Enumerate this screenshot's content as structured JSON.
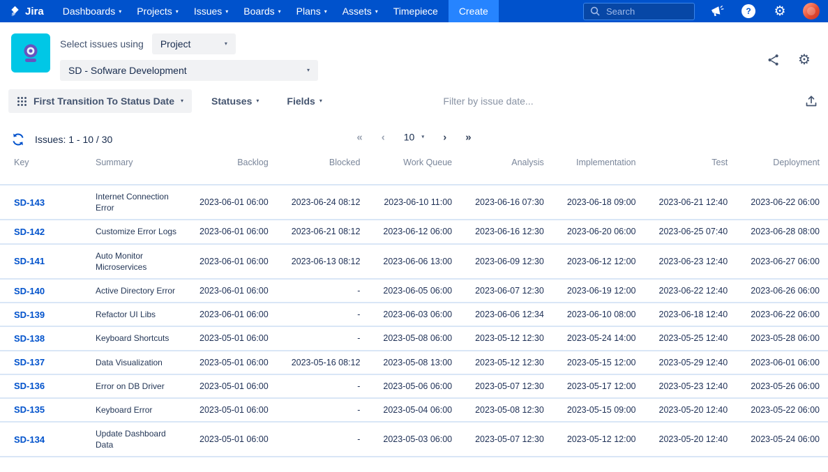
{
  "nav": {
    "brand": "Jira",
    "items": [
      {
        "label": "Dashboards",
        "chevron": true
      },
      {
        "label": "Projects",
        "chevron": true
      },
      {
        "label": "Issues",
        "chevron": true
      },
      {
        "label": "Boards",
        "chevron": true
      },
      {
        "label": "Plans",
        "chevron": true
      },
      {
        "label": "Assets",
        "chevron": true
      },
      {
        "label": "Timepiece",
        "chevron": false
      }
    ],
    "create_label": "Create",
    "search_placeholder": "Search",
    "icons": [
      "announcement-icon",
      "help-icon",
      "settings-icon",
      "user-avatar"
    ]
  },
  "gadget_header": {
    "select_label": "Select issues using",
    "mode_selected": "Project",
    "project_selected": "SD - Sofware Development"
  },
  "toolbar": {
    "field_selector": "First Transition To Status Date",
    "statuses": "Statuses",
    "fields": "Fields",
    "filter_placeholder": "Filter by issue date..."
  },
  "pagination": {
    "issues_label": "Issues: 1 - 10 / 30",
    "page_size": "10"
  },
  "table": {
    "columns": [
      "Key",
      "Summary",
      "Backlog",
      "Blocked",
      "Work Queue",
      "Analysis",
      "Implementation",
      "Test",
      "Deployment"
    ],
    "rows": [
      {
        "key": "SD-143",
        "summary": "Internet Connection Error",
        "dates": [
          "2023-06-01 06:00",
          "2023-06-24 08:12",
          "2023-06-10 11:00",
          "2023-06-16 07:30",
          "2023-06-18 09:00",
          "2023-06-21 12:40",
          "2023-06-22 06:00"
        ]
      },
      {
        "key": "SD-142",
        "summary": "Customize Error Logs",
        "dates": [
          "2023-06-01 06:00",
          "2023-06-21 08:12",
          "2023-06-12 06:00",
          "2023-06-16 12:30",
          "2023-06-20 06:00",
          "2023-06-25 07:40",
          "2023-06-28 08:00"
        ]
      },
      {
        "key": "SD-141",
        "summary": "Auto Monitor Microservices",
        "dates": [
          "2023-06-01 06:00",
          "2023-06-13 08:12",
          "2023-06-06 13:00",
          "2023-06-09 12:30",
          "2023-06-12 12:00",
          "2023-06-23 12:40",
          "2023-06-27 06:00"
        ]
      },
      {
        "key": "SD-140",
        "summary": "Active Directory Error",
        "dates": [
          "2023-06-01 06:00",
          "-",
          "2023-06-05 06:00",
          "2023-06-07 12:30",
          "2023-06-19 12:00",
          "2023-06-22 12:40",
          "2023-06-26 06:00"
        ]
      },
      {
        "key": "SD-139",
        "summary": "Refactor UI Libs",
        "dates": [
          "2023-06-01 06:00",
          "-",
          "2023-06-03 06:00",
          "2023-06-06 12:34",
          "2023-06-10 08:00",
          "2023-06-18 12:40",
          "2023-06-22 06:00"
        ]
      },
      {
        "key": "SD-138",
        "summary": "Keyboard Shortcuts",
        "dates": [
          "2023-05-01 06:00",
          "-",
          "2023-05-08 06:00",
          "2023-05-12 12:30",
          "2023-05-24 14:00",
          "2023-05-25 12:40",
          "2023-05-28 06:00"
        ]
      },
      {
        "key": "SD-137",
        "summary": "Data Visualization",
        "dates": [
          "2023-05-01 06:00",
          "2023-05-16 08:12",
          "2023-05-08 13:00",
          "2023-05-12 12:30",
          "2023-05-15 12:00",
          "2023-05-29 12:40",
          "2023-06-01 06:00"
        ]
      },
      {
        "key": "SD-136",
        "summary": "Error on DB Driver",
        "dates": [
          "2023-05-01 06:00",
          "-",
          "2023-05-06 06:00",
          "2023-05-07 12:30",
          "2023-05-17 12:00",
          "2023-05-23 12:40",
          "2023-05-26 06:00"
        ]
      },
      {
        "key": "SD-135",
        "summary": "Keyboard Error",
        "dates": [
          "2023-05-01 06:00",
          "-",
          "2023-05-04 06:00",
          "2023-05-08 12:30",
          "2023-05-15 09:00",
          "2023-05-20 12:40",
          "2023-05-22 06:00"
        ]
      },
      {
        "key": "SD-134",
        "summary": "Update Dashboard Data",
        "dates": [
          "2023-05-01 06:00",
          "-",
          "2023-05-03 06:00",
          "2023-05-07 12:30",
          "2023-05-12 12:00",
          "2023-05-20 12:40",
          "2023-05-24 06:00"
        ]
      }
    ]
  },
  "colors": {
    "nav_background": "#0052CC",
    "create_button": "#2684FF",
    "link": "#0052CC",
    "row_divider": "#D9E6F6",
    "gadget_icon_bg": "#00C7E6",
    "gadget_icon_fg": "#6554C0"
  }
}
